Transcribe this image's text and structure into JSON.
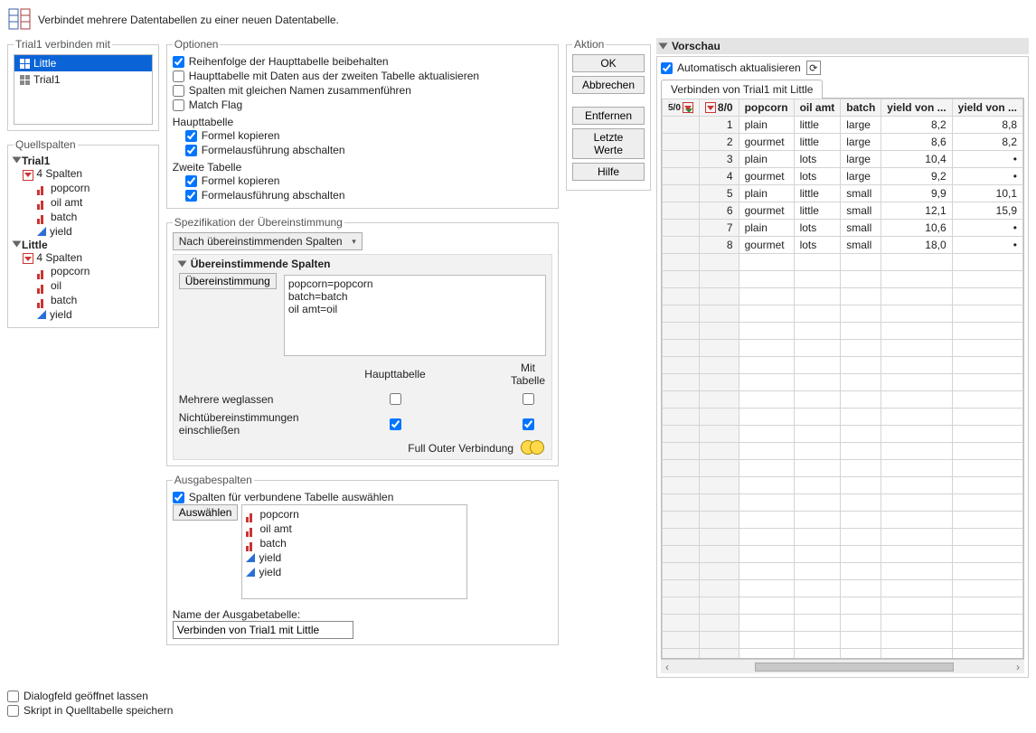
{
  "top": {
    "description": "Verbindet mehrere Datentabellen zu einer neuen Datentabelle."
  },
  "bind_with": {
    "legend": "Trial1 verbinden mit",
    "items": [
      "Little",
      "Trial1"
    ],
    "selected": "Little"
  },
  "quellspalten": {
    "legend": "Quellspalten",
    "tables": [
      {
        "name": "Trial1",
        "count": "4 Spalten",
        "cols": [
          {
            "icon": "nom",
            "name": "popcorn"
          },
          {
            "icon": "nom",
            "name": "oil amt"
          },
          {
            "icon": "nom",
            "name": "batch"
          },
          {
            "icon": "cont",
            "name": "yield"
          }
        ]
      },
      {
        "name": "Little",
        "count": "4 Spalten",
        "cols": [
          {
            "icon": "nom",
            "name": "popcorn"
          },
          {
            "icon": "nom",
            "name": "oil"
          },
          {
            "icon": "nom",
            "name": "batch"
          },
          {
            "icon": "cont",
            "name": "yield"
          }
        ]
      }
    ]
  },
  "optionen": {
    "legend": "Optionen",
    "opts": {
      "keep_order": {
        "label": "Reihenfolge der Haupttabelle beibehalten",
        "checked": true
      },
      "update_main": {
        "label": "Haupttabelle mit Daten aus der zweiten Tabelle aktualisieren",
        "checked": false
      },
      "merge_same": {
        "label": "Spalten mit gleichen Namen zusammenführen",
        "checked": false
      },
      "match_flag": {
        "label": "Match Flag",
        "checked": false
      }
    },
    "haupttabelle_label": "Haupttabelle",
    "zweite_label": "Zweite Tabelle",
    "copy_formula": "Formel kopieren",
    "disable_formula": "Formelausführung abschalten",
    "copy_formula1_checked": true,
    "disable_formula1_checked": true,
    "copy_formula2_checked": true,
    "disable_formula2_checked": true
  },
  "aktion": {
    "legend": "Aktion",
    "ok": "OK",
    "cancel": "Abbrechen",
    "remove": "Entfernen",
    "recall": "Letzte Werte",
    "help": "Hilfe"
  },
  "spec": {
    "legend": "Spezifikation der Übereinstimmung",
    "dropdown": "Nach übereinstimmenden Spalten",
    "panel_title": "Übereinstimmende Spalten",
    "match_btn": "Übereinstimmung",
    "matches": [
      "popcorn=popcorn",
      "batch=batch",
      "oil amt=oil"
    ],
    "hdr_main": "Haupttabelle",
    "hdr_with": "Mit Tabelle",
    "drop_multiples": "Mehrere weglassen",
    "include_nonmatch": "Nichtübereinstimmungen einschließen",
    "drop_main": false,
    "drop_with": false,
    "nm_main": true,
    "nm_with": true,
    "join_type": "Full Outer Verbindung"
  },
  "output": {
    "legend": "Ausgabespalten",
    "select_cols": {
      "label": "Spalten für verbundene Tabelle auswählen",
      "checked": true
    },
    "select_btn": "Auswählen",
    "cols": [
      {
        "icon": "nom",
        "name": "popcorn"
      },
      {
        "icon": "nom",
        "name": "oil amt"
      },
      {
        "icon": "nom",
        "name": "batch"
      },
      {
        "icon": "cont",
        "name": "yield"
      },
      {
        "icon": "cont",
        "name": "yield"
      }
    ],
    "outname_label": "Name der Ausgabetabelle:",
    "outname_value": "Verbinden von Trial1 mit Little"
  },
  "bottom": {
    "keep_open": {
      "label": "Dialogfeld geöffnet lassen",
      "checked": false
    },
    "save_script": {
      "label": "Skript in Quelltabelle speichern",
      "checked": false
    }
  },
  "preview": {
    "title": "Vorschau",
    "auto": {
      "label": "Automatisch aktualisieren",
      "checked": true
    },
    "tab": "Verbinden von Trial1 mit Little",
    "corner_top": "5/0",
    "corner_left": "8/0",
    "headers": [
      "popcorn",
      "oil amt",
      "batch",
      "yield von ...",
      "yield von ..."
    ],
    "rows": [
      {
        "n": 1,
        "c": [
          "plain",
          "little",
          "large",
          "8,2",
          "8,8"
        ]
      },
      {
        "n": 2,
        "c": [
          "gourmet",
          "little",
          "large",
          "8,6",
          "8,2"
        ]
      },
      {
        "n": 3,
        "c": [
          "plain",
          "lots",
          "large",
          "10,4",
          "•"
        ]
      },
      {
        "n": 4,
        "c": [
          "gourmet",
          "lots",
          "large",
          "9,2",
          "•"
        ]
      },
      {
        "n": 5,
        "c": [
          "plain",
          "little",
          "small",
          "9,9",
          "10,1"
        ]
      },
      {
        "n": 6,
        "c": [
          "gourmet",
          "little",
          "small",
          "12,1",
          "15,9"
        ]
      },
      {
        "n": 7,
        "c": [
          "plain",
          "lots",
          "small",
          "10,6",
          "•"
        ]
      },
      {
        "n": 8,
        "c": [
          "gourmet",
          "lots",
          "small",
          "18,0",
          "•"
        ]
      }
    ]
  }
}
